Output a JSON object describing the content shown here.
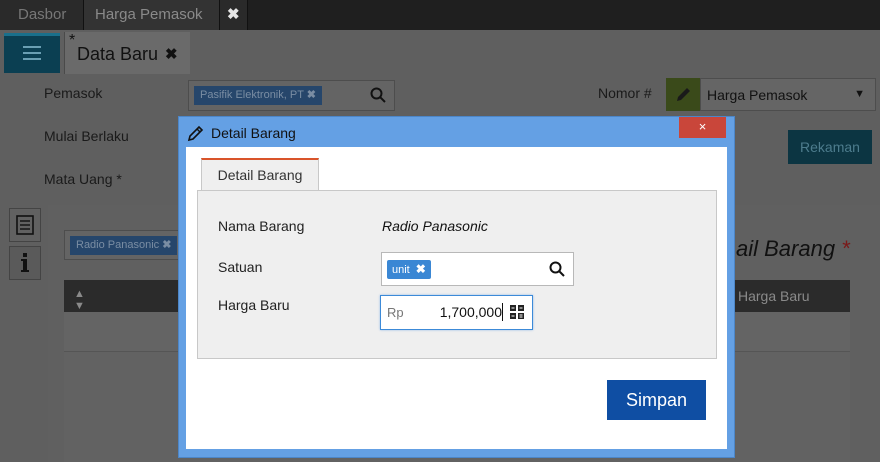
{
  "app_tabs": {
    "dashboard": "Dasbor",
    "supplier_price": "Harga Pemasok",
    "close": "✖"
  },
  "document": {
    "tab_star": "*",
    "tab_label": "Data Baru",
    "tab_close": "✖"
  },
  "form": {
    "supplier_label": "Pemasok",
    "supplier_value": "Pasifik Elektronik, PT",
    "effective_label": "Mulai Berlaku",
    "currency_label": "Mata Uang *",
    "number_label": "Nomor #",
    "number_select_value": "Harga Pemasok",
    "record_button": "Rekaman"
  },
  "background_panel": {
    "item_tag": "Radio Panasonic",
    "title_fragment": "ail Barang",
    "title_required": "*",
    "grid_column": "Harga Baru"
  },
  "modal": {
    "title": "Detail Barang",
    "close": "×",
    "tab_label": "Detail Barang",
    "item_name_label": "Nama Barang",
    "item_name_value": "Radio Panasonic",
    "unit_label": "Satuan",
    "unit_value": "unit",
    "new_price_label": "Harga Baru",
    "currency_prefix": "Rp",
    "new_price_value": "1,700,000",
    "save_button": "Simpan"
  },
  "colors": {
    "modal_header": "#64a0e4",
    "close_button": "#c9463a",
    "save_button": "#0f4ea3",
    "tag_blue": "#3a87d4",
    "active_tab_accent": "#d9542a"
  }
}
